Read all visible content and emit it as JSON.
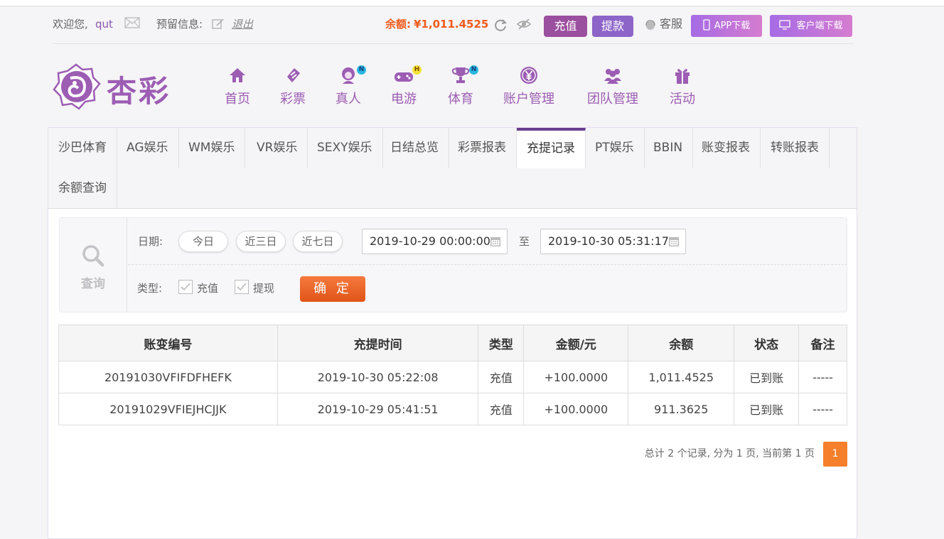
{
  "topbar": {
    "welcome": "欢迎您,",
    "username": "qut",
    "reserved_label": "预留信息:",
    "logout": "退出",
    "balance_label": "余额:",
    "balance_value": "¥1,011.4525",
    "deposit": "充值",
    "withdraw": "提款",
    "service": "客服",
    "app_download": "APP下载",
    "client_download": "客户端下载"
  },
  "logo_text": "杏彩",
  "nav": [
    {
      "label": "首页",
      "icon": "home-icon"
    },
    {
      "label": "彩票",
      "icon": "lottery-icon"
    },
    {
      "label": "真人",
      "icon": "live-dealer-icon",
      "badge": "N"
    },
    {
      "label": "电游",
      "icon": "gamepad-icon",
      "badge": "H"
    },
    {
      "label": "体育",
      "icon": "trophy-icon",
      "badge": "N"
    },
    {
      "label": "账户管理",
      "icon": "yen-coin-icon"
    },
    {
      "label": "团队管理",
      "icon": "team-icon"
    },
    {
      "label": "活动",
      "icon": "gift-icon"
    }
  ],
  "tabs": [
    "沙巴体育",
    "AG娱乐",
    "WM娱乐",
    "VR娱乐",
    "SEXY娱乐",
    "日结总览",
    "彩票报表",
    "充提记录",
    "PT娱乐",
    "BBIN",
    "账变报表",
    "转账报表",
    "余额查询"
  ],
  "active_tab": "充提记录",
  "query": {
    "icon_label": "查询",
    "date_label": "日期:",
    "today": "今日",
    "last3": "近三日",
    "last7": "近七日",
    "start": "2019-10-29 00:00:00",
    "to": "至",
    "end": "2019-10-30 05:31:17",
    "type_label": "类型:",
    "type_deposit": "充值",
    "type_withdraw": "提现",
    "confirm": "确 定"
  },
  "table": {
    "headers": [
      "账变编号",
      "充提时间",
      "类型",
      "金额/元",
      "余额",
      "状态",
      "备注"
    ],
    "rows": [
      [
        "20191030VFIFDFHEFK",
        "2019-10-30 05:22:08",
        "充值",
        "+100.0000",
        "1,011.4525",
        "已到账",
        "-----"
      ],
      [
        "20191029VFIEJHCJJK",
        "2019-10-29 05:41:51",
        "充值",
        "+100.0000",
        "911.3625",
        "已到账",
        "-----"
      ]
    ]
  },
  "pager": {
    "summary": "总计 2 个记录, 分为 1 页, 当前第 1 页",
    "current": "1"
  },
  "colors": {
    "brand_purple": "#9c5db3",
    "deposit_btn": "#9b4f9f",
    "withdraw_btn": "#8d64c8",
    "confirm_orange": "#e85d1f",
    "amount_red": "#e21b1b",
    "status_green": "#2e9b2e"
  }
}
